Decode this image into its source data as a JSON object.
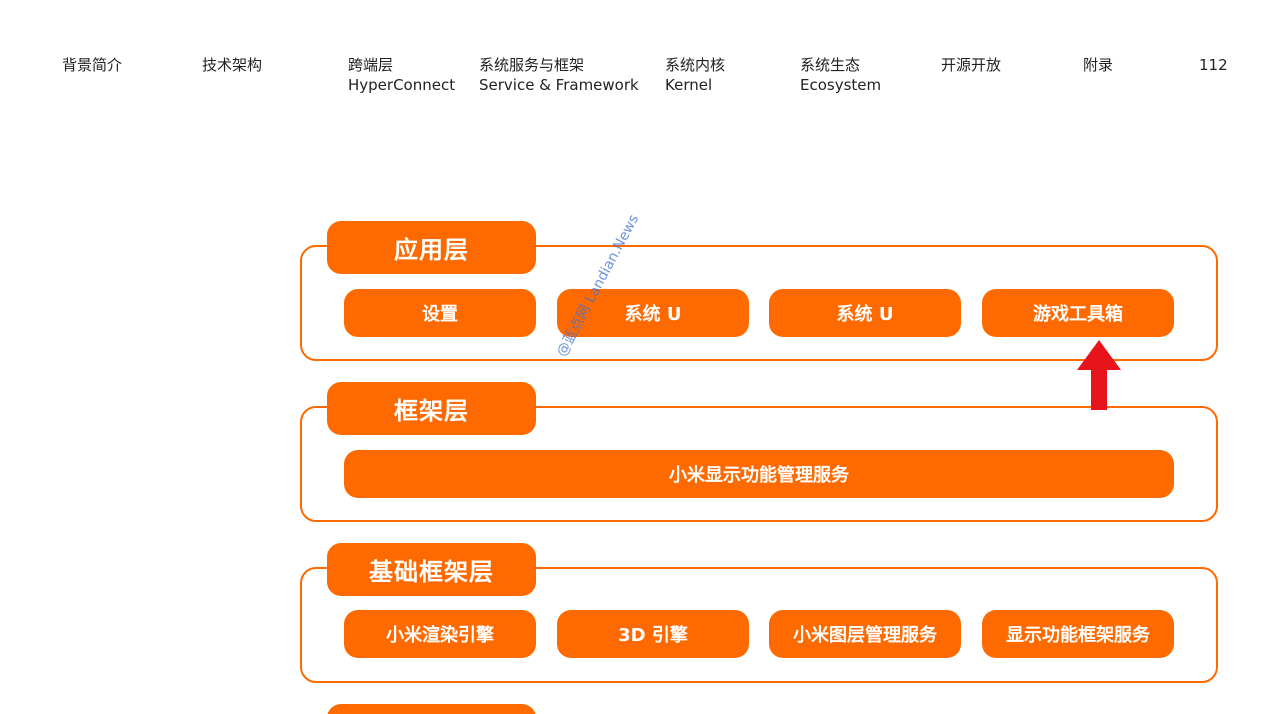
{
  "nav": {
    "intro": "背景简介",
    "architecture": "技术架构",
    "crossend": {
      "zh": "跨端层",
      "en": "HyperConnect"
    },
    "service": {
      "zh": "系统服务与框架",
      "en": "Service & Framework"
    },
    "kernel": {
      "zh": "系统内核",
      "en": "Kernel"
    },
    "ecosystem": {
      "zh": "系统生态",
      "en": "Ecosystem"
    },
    "opensource": "开源开放",
    "appendix": "附录",
    "page_number": "112"
  },
  "diagram": {
    "app_layer": {
      "title": "应用层",
      "modules": [
        "设置",
        "系统 U",
        "系统 U",
        "游戏工具箱"
      ]
    },
    "framework_layer": {
      "title": "框架层",
      "modules": [
        "小米显示功能管理服务"
      ]
    },
    "base_framework_layer": {
      "title": "基础框架层",
      "modules": [
        "小米渲染引擎",
        "3D 引擎",
        "小米图层管理服务",
        "显示功能框架服务"
      ]
    }
  },
  "watermark": "@蓝点网 Landian.News",
  "colors": {
    "accent": "#ff6a00",
    "arrow": "#e8141b",
    "watermark": "#3d6fd8"
  }
}
